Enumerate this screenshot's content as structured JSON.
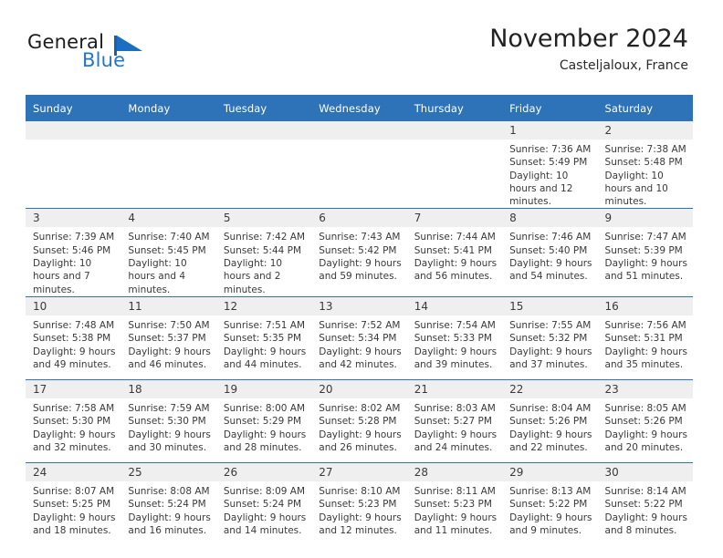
{
  "brand": {
    "name_part1": "General",
    "name_part2": "Blue",
    "flag_icon": "blue-triangle-flag"
  },
  "header": {
    "title": "November 2024",
    "subtitle": "Casteljaloux, France"
  },
  "calendar": {
    "weekday_headers": [
      "Sunday",
      "Monday",
      "Tuesday",
      "Wednesday",
      "Thursday",
      "Friday",
      "Saturday"
    ],
    "accent_color": "#2E72B8",
    "daynum_band_color": "#efefef",
    "weeks": [
      [
        {
          "day": "",
          "empty": true
        },
        {
          "day": "",
          "empty": true
        },
        {
          "day": "",
          "empty": true
        },
        {
          "day": "",
          "empty": true
        },
        {
          "day": "",
          "empty": true
        },
        {
          "day": "1",
          "sunrise": "Sunrise: 7:36 AM",
          "sunset": "Sunset: 5:49 PM",
          "daylight": "Daylight: 10 hours and 12 minutes."
        },
        {
          "day": "2",
          "sunrise": "Sunrise: 7:38 AM",
          "sunset": "Sunset: 5:48 PM",
          "daylight": "Daylight: 10 hours and 10 minutes."
        }
      ],
      [
        {
          "day": "3",
          "sunrise": "Sunrise: 7:39 AM",
          "sunset": "Sunset: 5:46 PM",
          "daylight": "Daylight: 10 hours and 7 minutes."
        },
        {
          "day": "4",
          "sunrise": "Sunrise: 7:40 AM",
          "sunset": "Sunset: 5:45 PM",
          "daylight": "Daylight: 10 hours and 4 minutes."
        },
        {
          "day": "5",
          "sunrise": "Sunrise: 7:42 AM",
          "sunset": "Sunset: 5:44 PM",
          "daylight": "Daylight: 10 hours and 2 minutes."
        },
        {
          "day": "6",
          "sunrise": "Sunrise: 7:43 AM",
          "sunset": "Sunset: 5:42 PM",
          "daylight": "Daylight: 9 hours and 59 minutes."
        },
        {
          "day": "7",
          "sunrise": "Sunrise: 7:44 AM",
          "sunset": "Sunset: 5:41 PM",
          "daylight": "Daylight: 9 hours and 56 minutes."
        },
        {
          "day": "8",
          "sunrise": "Sunrise: 7:46 AM",
          "sunset": "Sunset: 5:40 PM",
          "daylight": "Daylight: 9 hours and 54 minutes."
        },
        {
          "day": "9",
          "sunrise": "Sunrise: 7:47 AM",
          "sunset": "Sunset: 5:39 PM",
          "daylight": "Daylight: 9 hours and 51 minutes."
        }
      ],
      [
        {
          "day": "10",
          "sunrise": "Sunrise: 7:48 AM",
          "sunset": "Sunset: 5:38 PM",
          "daylight": "Daylight: 9 hours and 49 minutes."
        },
        {
          "day": "11",
          "sunrise": "Sunrise: 7:50 AM",
          "sunset": "Sunset: 5:37 PM",
          "daylight": "Daylight: 9 hours and 46 minutes."
        },
        {
          "day": "12",
          "sunrise": "Sunrise: 7:51 AM",
          "sunset": "Sunset: 5:35 PM",
          "daylight": "Daylight: 9 hours and 44 minutes."
        },
        {
          "day": "13",
          "sunrise": "Sunrise: 7:52 AM",
          "sunset": "Sunset: 5:34 PM",
          "daylight": "Daylight: 9 hours and 42 minutes."
        },
        {
          "day": "14",
          "sunrise": "Sunrise: 7:54 AM",
          "sunset": "Sunset: 5:33 PM",
          "daylight": "Daylight: 9 hours and 39 minutes."
        },
        {
          "day": "15",
          "sunrise": "Sunrise: 7:55 AM",
          "sunset": "Sunset: 5:32 PM",
          "daylight": "Daylight: 9 hours and 37 minutes."
        },
        {
          "day": "16",
          "sunrise": "Sunrise: 7:56 AM",
          "sunset": "Sunset: 5:31 PM",
          "daylight": "Daylight: 9 hours and 35 minutes."
        }
      ],
      [
        {
          "day": "17",
          "sunrise": "Sunrise: 7:58 AM",
          "sunset": "Sunset: 5:30 PM",
          "daylight": "Daylight: 9 hours and 32 minutes."
        },
        {
          "day": "18",
          "sunrise": "Sunrise: 7:59 AM",
          "sunset": "Sunset: 5:30 PM",
          "daylight": "Daylight: 9 hours and 30 minutes."
        },
        {
          "day": "19",
          "sunrise": "Sunrise: 8:00 AM",
          "sunset": "Sunset: 5:29 PM",
          "daylight": "Daylight: 9 hours and 28 minutes."
        },
        {
          "day": "20",
          "sunrise": "Sunrise: 8:02 AM",
          "sunset": "Sunset: 5:28 PM",
          "daylight": "Daylight: 9 hours and 26 minutes."
        },
        {
          "day": "21",
          "sunrise": "Sunrise: 8:03 AM",
          "sunset": "Sunset: 5:27 PM",
          "daylight": "Daylight: 9 hours and 24 minutes."
        },
        {
          "day": "22",
          "sunrise": "Sunrise: 8:04 AM",
          "sunset": "Sunset: 5:26 PM",
          "daylight": "Daylight: 9 hours and 22 minutes."
        },
        {
          "day": "23",
          "sunrise": "Sunrise: 8:05 AM",
          "sunset": "Sunset: 5:26 PM",
          "daylight": "Daylight: 9 hours and 20 minutes."
        }
      ],
      [
        {
          "day": "24",
          "sunrise": "Sunrise: 8:07 AM",
          "sunset": "Sunset: 5:25 PM",
          "daylight": "Daylight: 9 hours and 18 minutes."
        },
        {
          "day": "25",
          "sunrise": "Sunrise: 8:08 AM",
          "sunset": "Sunset: 5:24 PM",
          "daylight": "Daylight: 9 hours and 16 minutes."
        },
        {
          "day": "26",
          "sunrise": "Sunrise: 8:09 AM",
          "sunset": "Sunset: 5:24 PM",
          "daylight": "Daylight: 9 hours and 14 minutes."
        },
        {
          "day": "27",
          "sunrise": "Sunrise: 8:10 AM",
          "sunset": "Sunset: 5:23 PM",
          "daylight": "Daylight: 9 hours and 12 minutes."
        },
        {
          "day": "28",
          "sunrise": "Sunrise: 8:11 AM",
          "sunset": "Sunset: 5:23 PM",
          "daylight": "Daylight: 9 hours and 11 minutes."
        },
        {
          "day": "29",
          "sunrise": "Sunrise: 8:13 AM",
          "sunset": "Sunset: 5:22 PM",
          "daylight": "Daylight: 9 hours and 9 minutes."
        },
        {
          "day": "30",
          "sunrise": "Sunrise: 8:14 AM",
          "sunset": "Sunset: 5:22 PM",
          "daylight": "Daylight: 9 hours and 8 minutes."
        }
      ]
    ]
  }
}
